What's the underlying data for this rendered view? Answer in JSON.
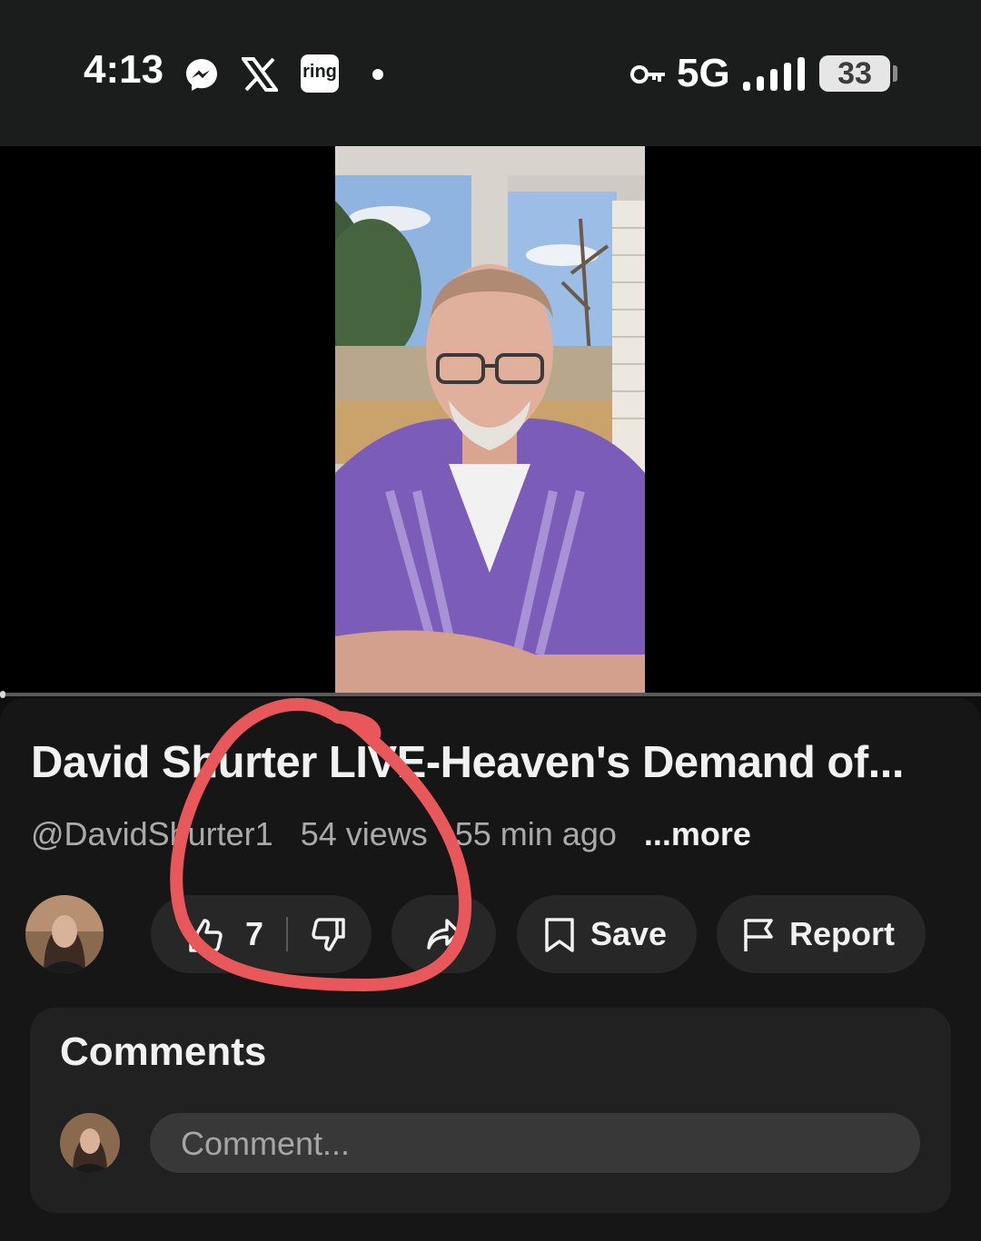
{
  "status_bar": {
    "time": "4:13",
    "network": "5G",
    "battery": "33",
    "icons": [
      "messenger-icon",
      "x-icon",
      "ring-icon",
      "dot-icon",
      "vpn-key-icon",
      "signal-icon",
      "battery-icon"
    ],
    "ring_label": "ring"
  },
  "video": {
    "description_colors": {
      "shirt": "#7b5cb8",
      "sky": "#8fb4e0",
      "fence": "#c9a36b"
    },
    "progress": 0
  },
  "info": {
    "title": "David Shurter LIVE-Heaven's Demand of...",
    "channel": "@DavidShurter1",
    "views": "54 views",
    "age": "55 min ago",
    "more": "...more"
  },
  "actions": {
    "like_count": "7",
    "save_label": "Save",
    "report_label": "Report"
  },
  "comments": {
    "title": "Comments",
    "placeholder": "Comment..."
  },
  "colors": {
    "background": "#0f0f0f",
    "panel": "#161616",
    "pill": "#272727",
    "annotation": "#e8585a"
  }
}
